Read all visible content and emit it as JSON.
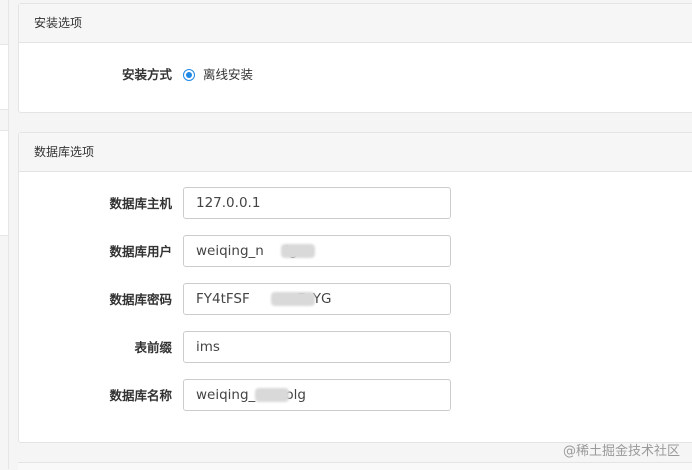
{
  "install_panel": {
    "heading": "安装选项",
    "method_label": "安装方式",
    "method_option": "离线安装"
  },
  "db_panel": {
    "heading": "数据库选项",
    "fields": [
      {
        "label": "数据库主机",
        "value": "127.0.0.1"
      },
      {
        "label": "数据库用户",
        "value": "weiqing_n     lg"
      },
      {
        "label": "数据库密码",
        "value": "FY4tFSF        mEsYG"
      },
      {
        "label": "表前缀",
        "value": "ims"
      },
      {
        "label": "数据库名称",
        "value": "weiqing_       olg"
      }
    ]
  },
  "watermark": "@稀土掘金技术社区",
  "colors": {
    "accent": "#1e88e5",
    "border": "#cccccc",
    "heading_bg": "#f6f6f6"
  }
}
